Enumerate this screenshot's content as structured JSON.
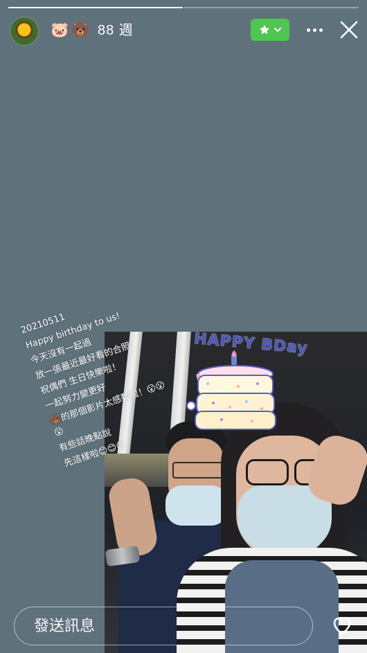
{
  "story": {
    "progress": {
      "segments": 2,
      "viewed": 1
    },
    "author": {
      "avatar_icon": "sunflower-avatar",
      "emoji_1": "🐷",
      "emoji_2": "🐻",
      "meta": "88 週"
    },
    "actions": {
      "star_icon": "star-icon",
      "more_icon": "more-dots-icon",
      "close_icon": "close-icon"
    },
    "caption_lines": [
      "20210511",
      "Happy birthday to us!",
      "今天沒有一起過",
      "放一張最近最好看的合照",
      "祝偶們 生日快樂啦！",
      "一起努力變更好",
      "🐻的那個影片太感動啦！😮😮😮",
      "有些話晚點說",
      "先這樣啦😊😊😊"
    ],
    "sticker_text": "HAPPY BDay"
  },
  "reply": {
    "placeholder": "發送訊息",
    "like_icon": "heart-icon"
  },
  "colors": {
    "background": "#5f717b",
    "star_button": "#4ec651",
    "text": "#ffffff"
  }
}
